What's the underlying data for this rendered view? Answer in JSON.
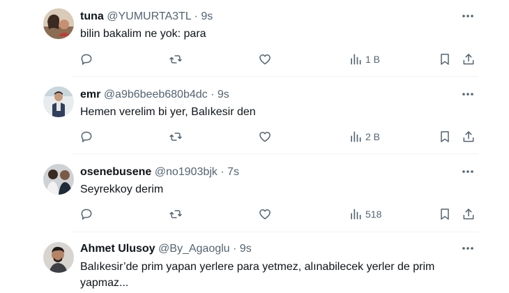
{
  "tweets": [
    {
      "name": "tuna",
      "handle": "@YUMURTA3TL",
      "dot": "·",
      "time": "9s",
      "text": "bilin bakalim ne yok:  para",
      "views": "1 B"
    },
    {
      "name": "emr",
      "handle": "@a9b6beeb680b4dc",
      "dot": "·",
      "time": "9s",
      "text": "Hemen verelim bi yer, Balıkesir den",
      "views": "2 B"
    },
    {
      "name": "osenebusene",
      "handle": "@no1903bjk",
      "dot": "·",
      "time": "7s",
      "text": "Seyrekkoy derim",
      "views": "518"
    },
    {
      "name": "Ahmet Ulusoy",
      "handle": "@By_Agaoglu",
      "dot": "·",
      "time": "9s",
      "text": "Balıkesir’de prim yapan yerlere para yetmez, alınabilecek yerler de prim yapmaz..."
    }
  ],
  "icons": {
    "reply": "reply-icon",
    "retweet": "retweet-icon",
    "like": "like-icon",
    "views": "views-icon",
    "bookmark": "bookmark-icon",
    "share": "share-icon",
    "more": "more-icon"
  },
  "colors": {
    "text": "#0f1419",
    "secondary": "#536471",
    "divider": "#eff3f4"
  }
}
